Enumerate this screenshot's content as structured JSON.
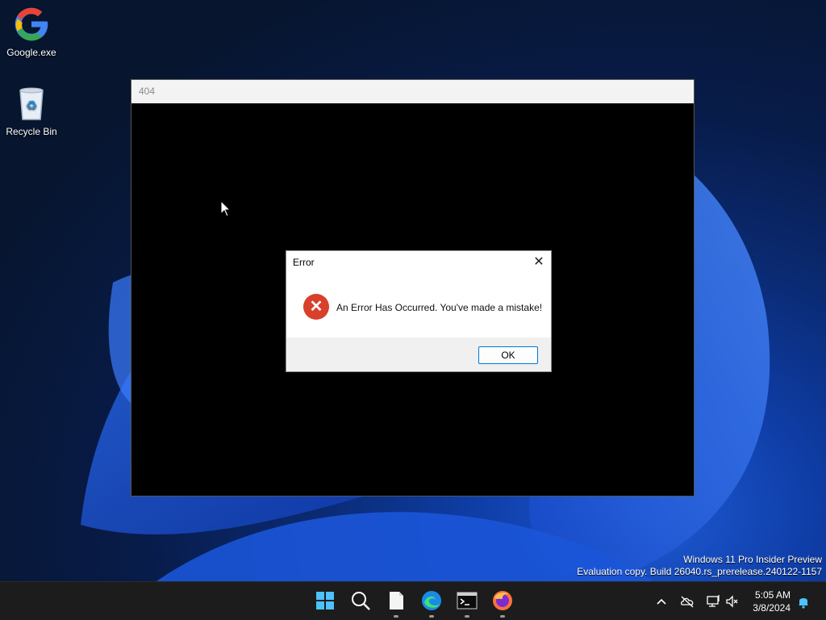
{
  "desktop": {
    "icons": [
      {
        "label": "Google.exe",
        "icon": "google-icon"
      },
      {
        "label": "Recycle Bin",
        "icon": "recycle-bin-icon"
      }
    ],
    "watermark": {
      "line1": "Windows 11 Pro Insider Preview",
      "line2": "Evaluation copy. Build 26040.rs_prerelease.240122-1157"
    }
  },
  "window": {
    "title": "404"
  },
  "dialog": {
    "title": "Error",
    "close_glyph": "✕",
    "message": "An Error Has Occurred. You've made a mistake!",
    "ok_label": "OK",
    "error_glyph": "✕"
  },
  "taskbar": {
    "apps": [
      "windows-start-icon",
      "search-icon",
      "file-explorer-icon",
      "edge-icon",
      "terminal-icon",
      "firefox-icon"
    ],
    "clock": {
      "time": "5:05 AM",
      "date": "3/8/2024"
    }
  },
  "colors": {
    "error_red": "#d8402a",
    "accent": "#0078d4"
  }
}
